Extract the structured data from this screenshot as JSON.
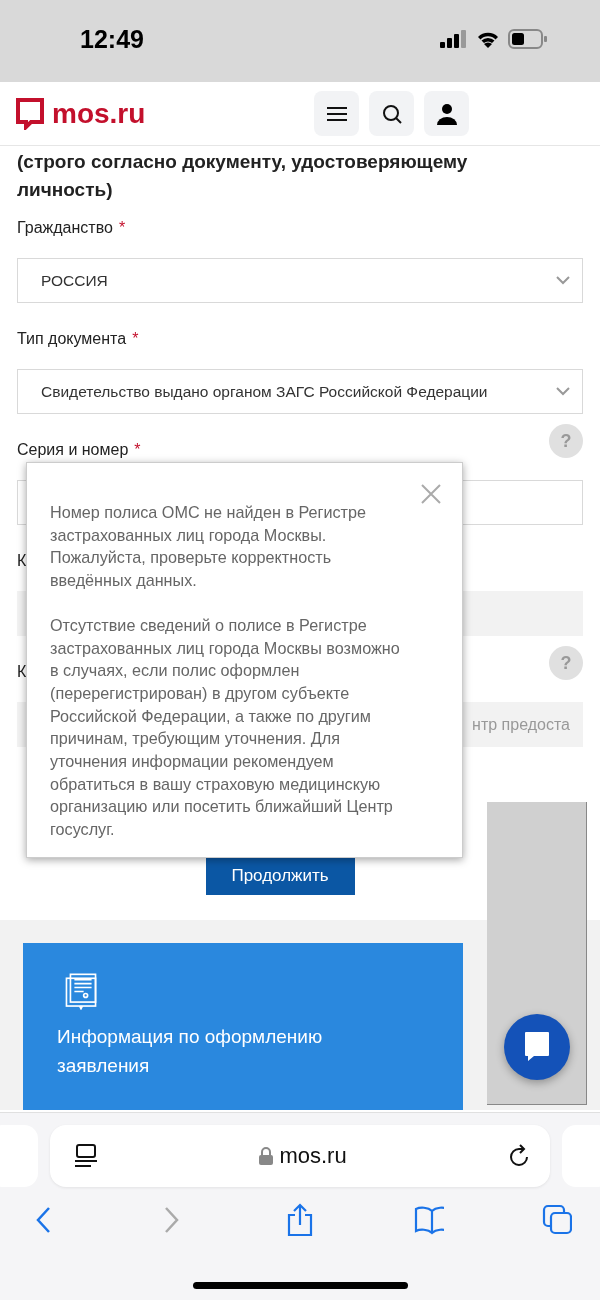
{
  "status_bar": {
    "time": "12:49"
  },
  "header": {
    "logo": "mos.ru"
  },
  "form": {
    "heading": "(строго согласно документу, удостоверяющему личность)",
    "fields": [
      {
        "label": "Гражданство",
        "required_mark": "*",
        "kind": "select",
        "value": "РОССИЯ"
      },
      {
        "label": "Тип документа",
        "required_mark": "*",
        "kind": "select",
        "value": "Свидетельство выдано органом ЗАГС Российской Федерации"
      },
      {
        "label": "Серия и номер",
        "required_mark": "*",
        "kind": "input",
        "help": "?",
        "disabled": false
      },
      {
        "label": "К",
        "kind": "input",
        "disabled": true
      },
      {
        "label": "К",
        "kind": "input",
        "help": "?",
        "disabled": true,
        "placeholder": "нтр предоста"
      }
    ],
    "submit": "Продолжить"
  },
  "dialog": {
    "paragraphs": [
      "Номер полиса ОМС не найден в Регистре застрахованных лиц города Москвы. Пожалуйста, проверьте корректность введённых данных.",
      "Отсутствие сведений о полисе в Регистре застрахованных лиц города Москвы возможно в случаях, если полис оформлен (перерегистрирован) в другом субъекте Российской Федерации, а также по другим причинам, требующим уточнения. Для уточнения информации рекомендуем обратиться в вашу страховую медицинскую организацию или посетить ближайший Центр госуслуг."
    ]
  },
  "info_card": {
    "title": "Информация по оформлению заявления"
  },
  "browser": {
    "address": "mos.ru",
    "back_disabled": false,
    "forward_disabled": true
  }
}
